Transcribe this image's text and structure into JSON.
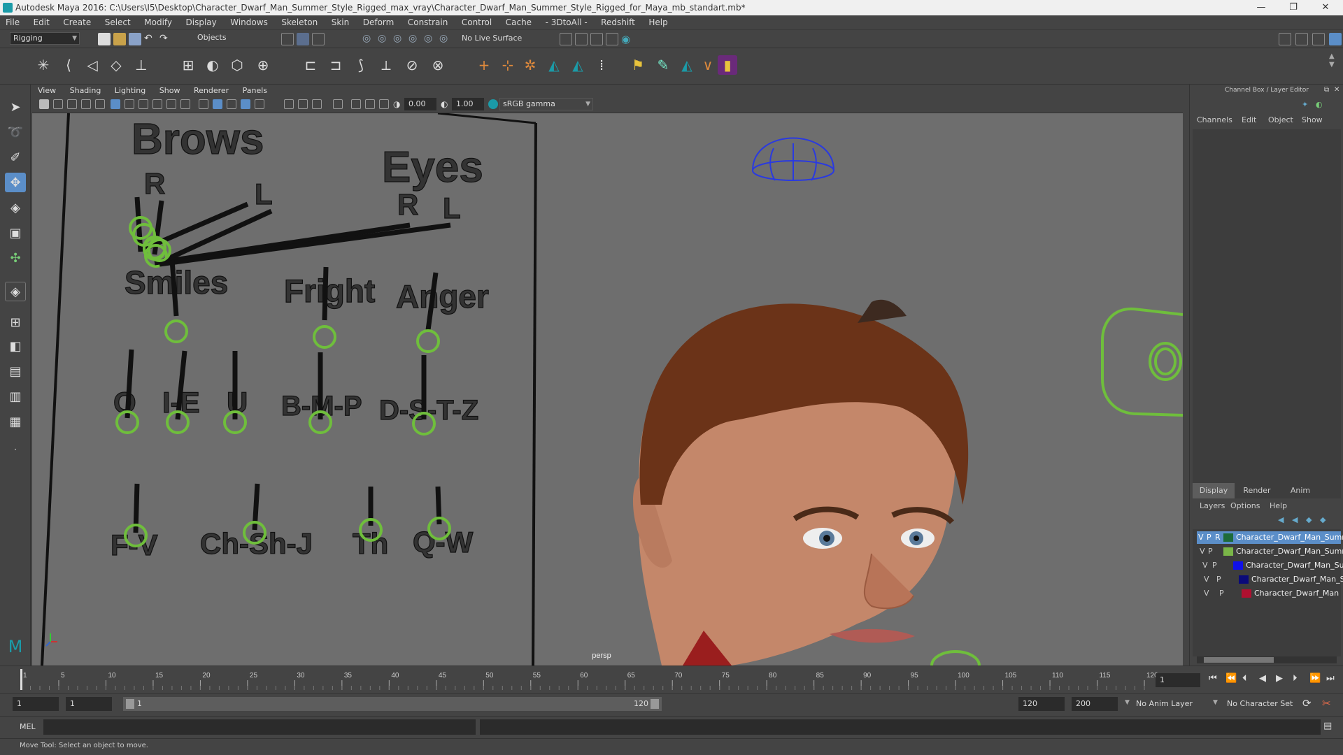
{
  "window": {
    "title": "Autodesk Maya 2016: C:\\Users\\I5\\Desktop\\Character_Dwarf_Man_Summer_Style_Rigged_max_vray\\Character_Dwarf_Man_Summer_Style_Rigged_for_Maya_mb_standart.mb*",
    "minimize": "—",
    "restore": "❐",
    "close": "✕"
  },
  "menubar": [
    "File",
    "Edit",
    "Create",
    "Select",
    "Modify",
    "Display",
    "Windows",
    "Skeleton",
    "Skin",
    "Deform",
    "Constrain",
    "Control",
    "Cache",
    "- 3DtoAll -",
    "Redshift",
    "Help"
  ],
  "statusline": {
    "menuset": "Rigging",
    "objects_label": "Objects",
    "live_surface": "No Live Surface"
  },
  "panel": {
    "menus": [
      "View",
      "Shading",
      "Lighting",
      "Show",
      "Renderer",
      "Panels"
    ],
    "near_value": "0.00",
    "far_value": "1.00",
    "color_space": "sRGB gamma",
    "camera_label": "persp"
  },
  "face_board": {
    "brows_title": "Brows",
    "brows_r": "R",
    "brows_l": "L",
    "eyes_title": "Eyes",
    "eyes_r": "R",
    "eyes_l": "L",
    "smiles": "Smiles",
    "fright": "Fright",
    "anger": "Anger",
    "o": "O",
    "ie": "I-E",
    "u": "U",
    "bmp": "B-M-P",
    "dstz": "D-S-T-Z",
    "fv": "F-V",
    "chshj": "Ch-Sh-J",
    "th": "Th",
    "qw": "Q-W"
  },
  "channel_box": {
    "header": "Channel Box / Layer Editor",
    "menus": [
      "Channels",
      "Edit",
      "Object",
      "Show"
    ],
    "tabs": [
      "Display",
      "Render",
      "Anim"
    ],
    "layer_menus": [
      "Layers",
      "Options",
      "Help"
    ],
    "layers": [
      {
        "v": "V",
        "p": "P",
        "r": "R",
        "name": "Character_Dwarf_Man_Summ",
        "color": "#1e6b3a",
        "selected": true
      },
      {
        "v": "V",
        "p": "P",
        "r": "",
        "name": "Character_Dwarf_Man_Summ",
        "color": "#7ab648",
        "selected": false
      },
      {
        "v": "V",
        "p": "P",
        "r": "",
        "name": "Character_Dwarf_Man_Su",
        "color": "#1010e8",
        "selected": false
      },
      {
        "v": "V",
        "p": "P",
        "r": "",
        "name": "Character_Dwarf_Man_S",
        "color": "#0a0a7a",
        "selected": false
      },
      {
        "v": "V",
        "p": "P",
        "r": "",
        "name": "Character_Dwarf_Man",
        "color": "#b01030",
        "selected": false
      }
    ]
  },
  "timeline": {
    "ticks": [
      "1",
      "5",
      "10",
      "15",
      "20",
      "25",
      "30",
      "35",
      "40",
      "45",
      "50",
      "55",
      "60",
      "65",
      "70",
      "75",
      "80",
      "85",
      "90",
      "95",
      "100",
      "105",
      "110",
      "115",
      "120"
    ],
    "current_frame": "1"
  },
  "range": {
    "start": "1",
    "playback_start": "1",
    "slider_start": "1",
    "slider_end": "120",
    "playback_end": "120",
    "end": "200",
    "anim_layer": "No Anim Layer",
    "character_set": "No Character Set"
  },
  "cmdline": {
    "label": "MEL"
  },
  "helpline": {
    "text": "Move Tool: Select an object to move."
  },
  "colors": {
    "maya_teal": "#1b9ba8",
    "control_green": "#6fbe3c",
    "selection_blue": "#5b8ec8"
  }
}
